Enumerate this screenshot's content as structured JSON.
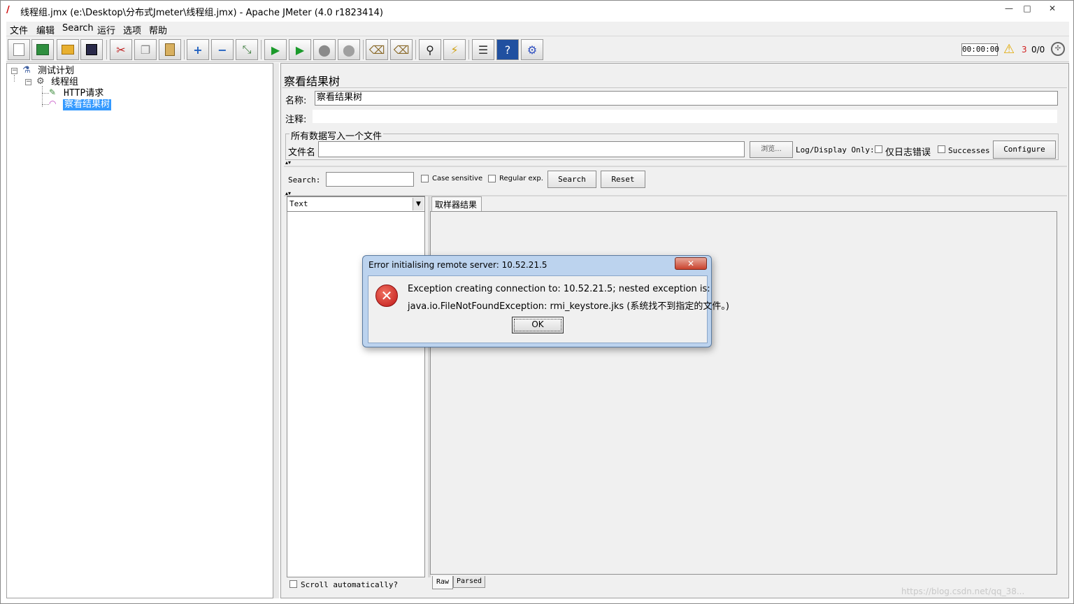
{
  "window": {
    "title": "线程组.jmx (e:\\Desktop\\分布式Jmeter\\线程组.jmx) - Apache JMeter (4.0 r1823414)",
    "minimize": "—",
    "maximize": "□",
    "close": "✕"
  },
  "menu": [
    "文件",
    "编辑",
    "Search",
    "运行",
    "选项",
    "帮助"
  ],
  "toolbar": {
    "timer": "00:00:00",
    "warning_count": "3",
    "thread_ratio": "0/0"
  },
  "tree": {
    "test_plan": "测试计划",
    "thread_group": "线程组",
    "http_request": "HTTP请求",
    "results_tree": "察看结果树"
  },
  "panel": {
    "title": "察看结果树",
    "name_label": "名称:",
    "name_value": "察看结果树",
    "comment_label": "注释:",
    "file_section": "所有数据写入一个文件",
    "filename_label": "文件名",
    "browse": "浏览...",
    "log_display": "Log/Display Only:",
    "errors_only": "仅日志错误",
    "successes": "Successes",
    "configure": "Configure"
  },
  "search": {
    "label": "Search:",
    "case_sensitive": "Case sensitive",
    "regular_exp": "Regular exp.",
    "search_button": "Search",
    "reset_button": "Reset"
  },
  "results": {
    "renderer": "Text",
    "tab": "取样器结果",
    "scroll_auto": "Scroll automatically?",
    "raw_tab": "Raw",
    "parsed_tab": "Parsed"
  },
  "dialog": {
    "title": "Error initialising remote server: 10.52.21.5",
    "line1": "Exception creating connection to: 10.52.21.5; nested exception is:",
    "line2": "java.io.FileNotFoundException: rmi_keystore.jks (系统找不到指定的文件。)",
    "ok": "OK"
  },
  "watermark": "https://blog.csdn.net/qq_38..."
}
